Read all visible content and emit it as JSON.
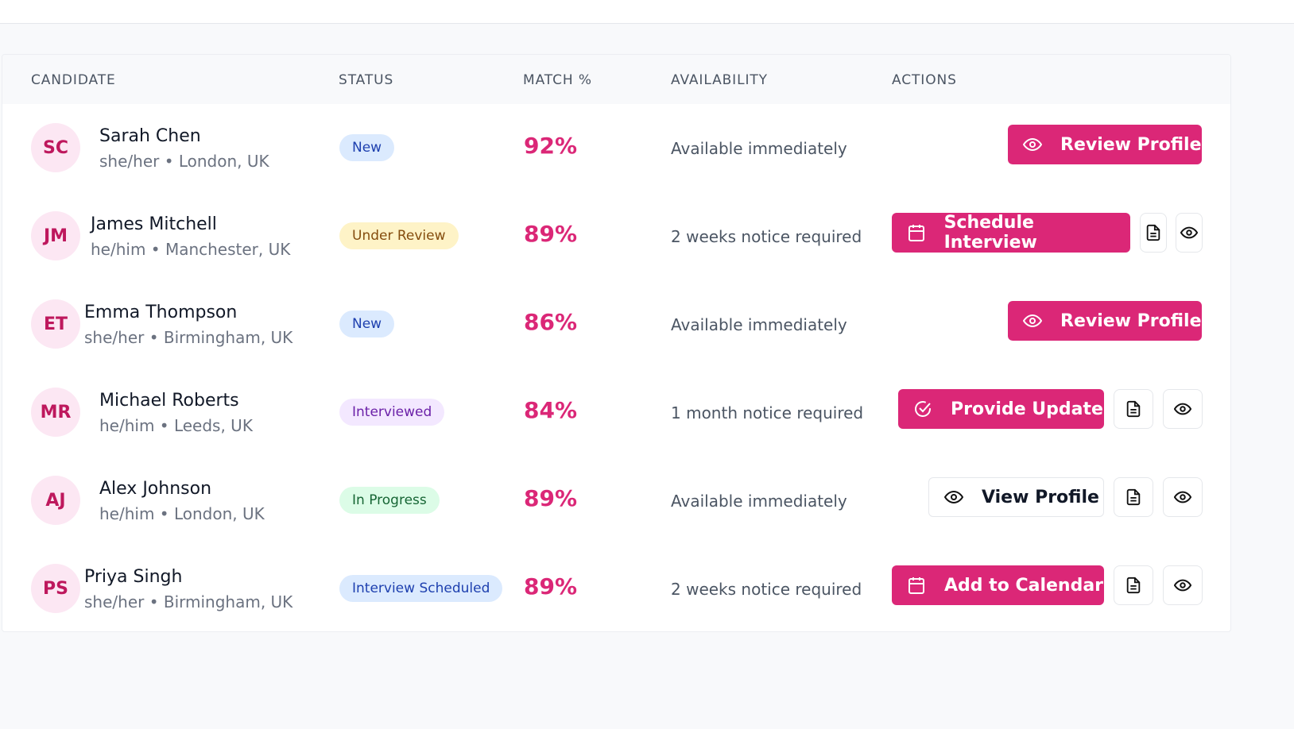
{
  "table": {
    "headers": [
      "CANDIDATE",
      "STATUS",
      "MATCH %",
      "AVAILABILITY",
      "ACTIONS"
    ],
    "rows": [
      {
        "initials": "SC",
        "name": "Sarah Chen",
        "meta": "she/her • London, UK",
        "status": "New",
        "match": "92%",
        "availability": "Available immediately",
        "action": "Review Profile",
        "action_icon": "eye-icon"
      },
      {
        "initials": "JM",
        "name": "James Mitchell",
        "meta": "he/him • Manchester, UK",
        "status": "Under Review",
        "match": "89%",
        "availability": "2 weeks notice required",
        "action": "Schedule Interview",
        "action_icon": "calendar-icon"
      },
      {
        "initials": "ET",
        "name": "Emma Thompson",
        "meta": "she/her • Birmingham, UK",
        "status": "New",
        "match": "86%",
        "availability": "Available immediately",
        "action": "Review Profile",
        "action_icon": "eye-icon"
      },
      {
        "initials": "MR",
        "name": "Michael Roberts",
        "meta": "he/him • Leeds, UK",
        "status": "Interviewed",
        "match": "84%",
        "availability": "1 month notice required",
        "action": "Provide Update",
        "action_icon": "check-circle-icon"
      },
      {
        "initials": "AJ",
        "name": "Alex Johnson",
        "meta": "he/him • London, UK",
        "status": "In Progress",
        "match": "89%",
        "availability": "Available immediately",
        "action": "View Profile",
        "action_icon": "eye-icon"
      },
      {
        "initials": "PS",
        "name": "Priya Singh",
        "meta": "she/her • Birmingham, UK",
        "status": "Interview Scheduled",
        "match": "89%",
        "availability": "2 weeks notice required",
        "action": "Add to Calendar",
        "action_icon": "calendar-icon"
      }
    ]
  },
  "colors": {
    "accent": "#db2777",
    "badge_new": "#dbeafe",
    "badge_under_review": "#fef3c7",
    "badge_interviewed": "#f3e8ff",
    "badge_in_progress": "#dcfce7",
    "badge_interview_scheduled": "#dbeafe"
  }
}
